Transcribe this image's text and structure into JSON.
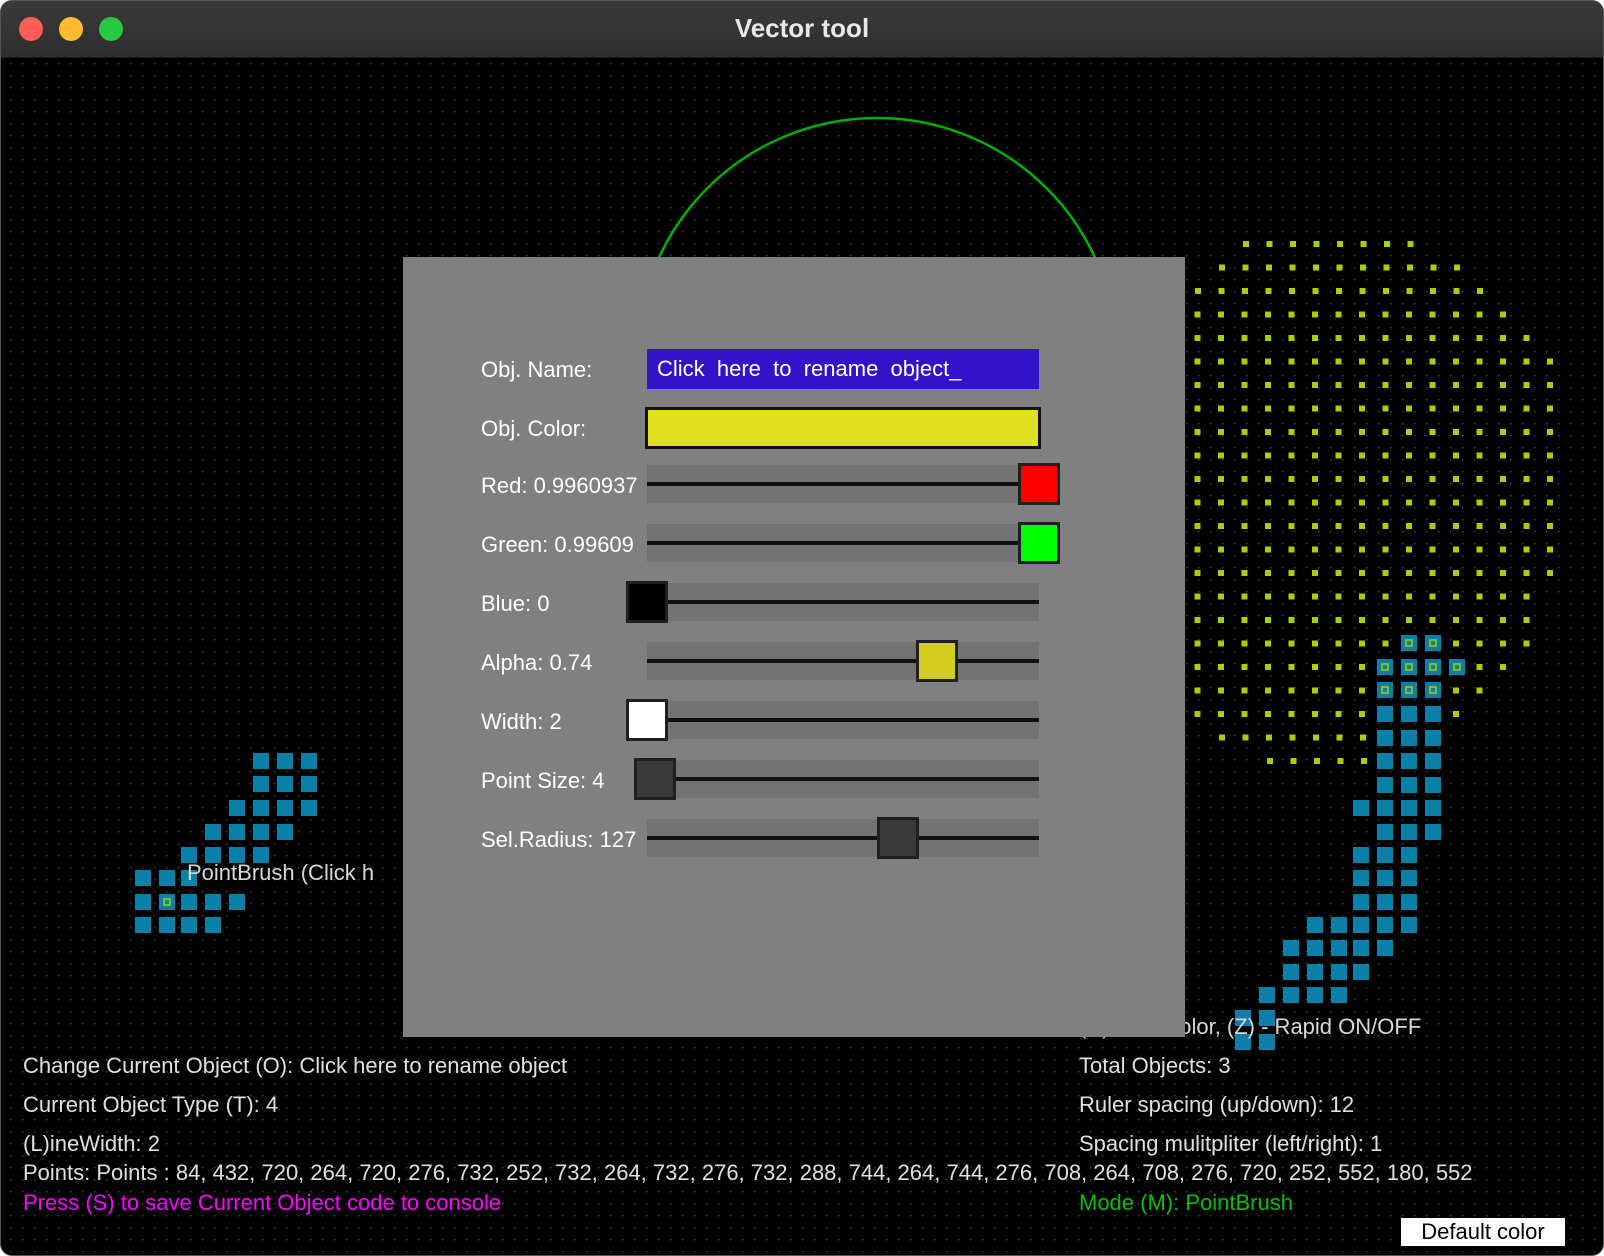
{
  "window": {
    "title": "Vector tool"
  },
  "colors": {
    "canvas_bg": "#000000",
    "grid_dot": "#4a4a4a",
    "arc": "#00b000",
    "green_points": "#a8d000",
    "blue_points": "#0a7fa8",
    "dialog_bg": "#808080",
    "name_field_bg": "#3313c9",
    "object_color": "#e0e020",
    "magenta_text": "#ff00ff",
    "mode_text": "#00c000"
  },
  "dialog": {
    "name_label": "Obj. Name:",
    "name_value": "Click  here  to  rename  object_",
    "color_label": "Obj. Color:",
    "sliders": [
      {
        "label": "Red: 0.9960937",
        "level": 1.0,
        "knob_color": "#ff0000"
      },
      {
        "label": "Green: 0.99609",
        "level": 1.0,
        "knob_color": "#00ff00"
      },
      {
        "label": "Blue: 0",
        "level": 0.0,
        "knob_color": "#000000"
      },
      {
        "label": "Alpha: 0.74",
        "level": 0.74,
        "knob_color": "#d4cc20"
      },
      {
        "label": "Width: 2",
        "level": 0.0,
        "knob_color": "#ffffff"
      },
      {
        "label": "Point Size: 4",
        "level": 0.02,
        "knob_color": "#3a3a3a"
      },
      {
        "label": "Sel.Radius: 127",
        "level": 0.64,
        "knob_color": "#3a3a3a"
      }
    ]
  },
  "canvas": {
    "pointbrush_label": "PointBrush (Click  h",
    "hint_partial": "(C) - Set color, (Z) - Rapid ON/OFF",
    "change_object": "Change Current Object (O): Click  here  to  rename  object",
    "object_type": "Current Object Type (T): 4",
    "line_width": "(L)ineWidth: 2",
    "total_objects": "Total Objects: 3",
    "ruler_spacing": "Ruler spacing (up/down): 12",
    "spacing_multiplier": "Spacing mulitpliter (left/right): 1",
    "points": "Points: Points : 84, 432, 720, 264, 720, 276, 732, 252, 732, 264, 732, 276, 732, 288, 744, 264, 744, 276, 708, 264, 708, 276, 720, 252, 552, 180, 552",
    "save_hint": "Press (S) to save Current Object code to console",
    "mode": "Mode (M): PointBrush",
    "default_color_button": "Default color"
  }
}
